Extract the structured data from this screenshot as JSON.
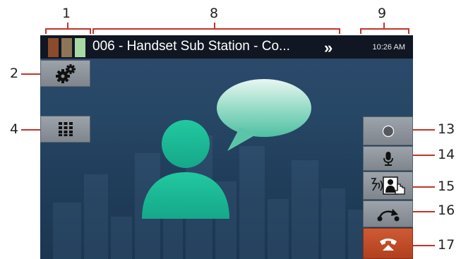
{
  "callouts": {
    "n1": "1",
    "n2": "2",
    "n4": "4",
    "n8": "8",
    "n9": "9",
    "n13": "13",
    "n14": "14",
    "n15": "15",
    "n16": "16",
    "n17": "17"
  },
  "status_bar": {
    "call_title": "006 - Handset Sub Station - Co...",
    "more_label": "»",
    "clock": "10:26 AM"
  },
  "icons": {
    "settings": "gears-icon",
    "keypad": "keypad-icon",
    "caller": "person-icon",
    "speech": "speech-bubble-icon",
    "record": "record-icon",
    "mute": "microphone-icon",
    "door_release": "door-release-icon",
    "transfer": "transfer-icon",
    "end_call": "end-call-icon"
  },
  "colors": {
    "accent_red": "#c4332b",
    "caller_green": "#1fbf9b",
    "end_call": "#c0502a",
    "level_1": "#8b4a2a",
    "level_2": "#8c7658",
    "level_3": "#a9d9a3"
  }
}
